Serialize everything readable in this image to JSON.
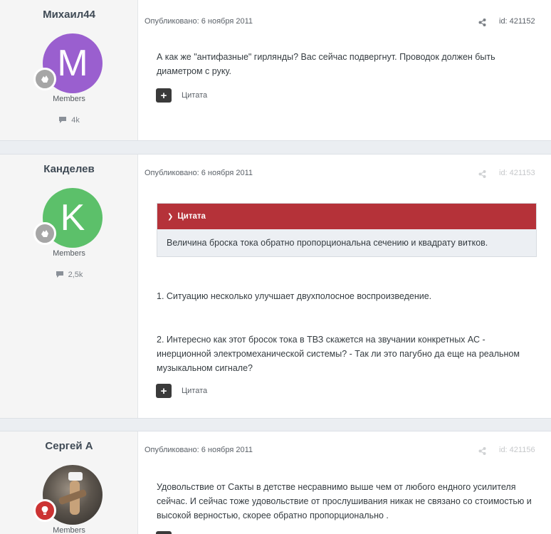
{
  "posts": [
    {
      "author": "Михаил44",
      "avatar_letter": "M",
      "avatar_color": "#9a5fcf",
      "role": "Members",
      "post_count": "4k",
      "published": "Опубликовано: 6 ноября 2011",
      "id_label": "id: 421152",
      "paragraphs": [
        "А как же \"антифазные\" гирлянды? Вас сейчас подвергнут. Проводок должен быть диаметром с руку."
      ],
      "quote_label": "Цитата"
    },
    {
      "author": "Канделев",
      "avatar_letter": "K",
      "avatar_color": "#5cc06a",
      "role": "Members",
      "post_count": "2,5k",
      "published": "Опубликовано: 6 ноября 2011",
      "id_label": "id: 421153",
      "quote_block": {
        "header": "Цитата",
        "text": "Величина броска тока обратно пропорциональна сечению и квадрату витков."
      },
      "paragraphs": [
        "1. Ситуацию несколько улучшает двухполосное воспроизведение.",
        "2. Интересно как этот бросок тока в ТВЗ скажется на звучании конкретных АС - инерционной электромеханической системы? - Так ли это пагубно да еще на реальном музыкальном сигнале?"
      ],
      "quote_label": "Цитата"
    },
    {
      "author": "Сергей А",
      "role": "Members",
      "published": "Опубликовано: 6 ноября 2011",
      "id_label": "id: 421156",
      "paragraphs": [
        "Удовольствие от Сакты в детстве несравнимо выше чем от любого ендного усилителя сейчас. И сейчас тоже удовольствие от прослушивания никак не связано со стоимостью и высокой верностью, скорее обратно пропорционально ."
      ]
    }
  ]
}
